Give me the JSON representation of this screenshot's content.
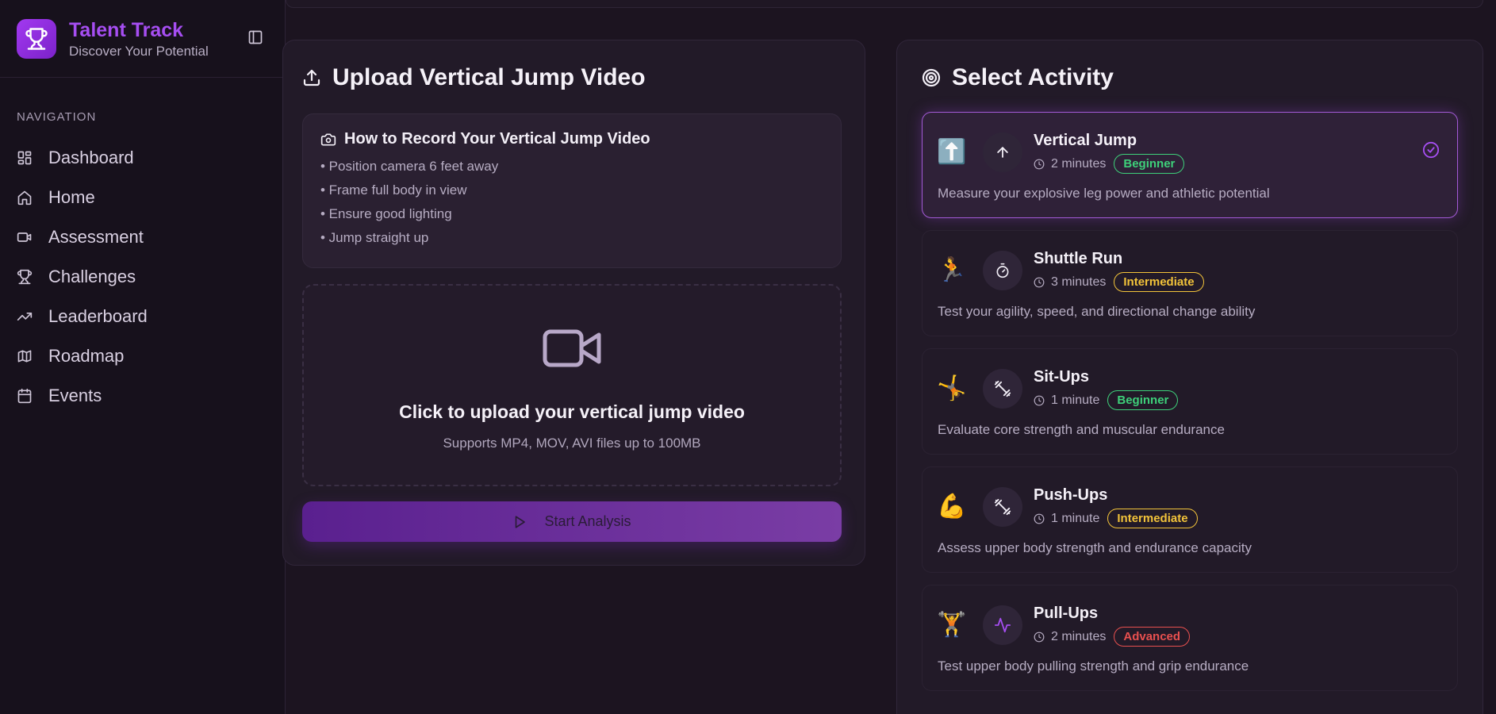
{
  "brand": {
    "title": "Talent Track",
    "subtitle": "Discover Your Potential"
  },
  "sidebar": {
    "section_label": "NAVIGATION",
    "items": [
      {
        "label": "Dashboard",
        "icon": "dashboard-icon"
      },
      {
        "label": "Home",
        "icon": "home-icon"
      },
      {
        "label": "Assessment",
        "icon": "video-icon"
      },
      {
        "label": "Challenges",
        "icon": "trophy-icon"
      },
      {
        "label": "Leaderboard",
        "icon": "trending-up-icon"
      },
      {
        "label": "Roadmap",
        "icon": "map-icon"
      },
      {
        "label": "Events",
        "icon": "calendar-icon"
      }
    ]
  },
  "upload": {
    "title": "Upload Vertical Jump Video",
    "howto_title": "How to Record Your Vertical Jump Video",
    "tips": [
      "• Position camera 6 feet away",
      "• Frame full body in view",
      "• Ensure good lighting",
      "• Jump straight up"
    ],
    "drop_title": "Click to upload your vertical jump video",
    "drop_sub": "Supports MP4, MOV, AVI files up to 100MB",
    "start_label": "Start Analysis"
  },
  "activities": {
    "title": "Select Activity",
    "items": [
      {
        "name": "Vertical Jump",
        "emoji": "⬆️",
        "icon": "arrow-up-icon",
        "duration": "2 minutes",
        "level": "Beginner",
        "level_color": "#3ed07a",
        "description": "Measure your explosive leg power and athletic potential",
        "selected": true
      },
      {
        "name": "Shuttle Run",
        "emoji": "🏃",
        "icon": "timer-icon",
        "duration": "3 minutes",
        "level": "Intermediate",
        "level_color": "#f2c33a",
        "description": "Test your agility, speed, and directional change ability",
        "selected": false
      },
      {
        "name": "Sit-Ups",
        "emoji": "🤸",
        "icon": "dumbbell-icon",
        "duration": "1 minute",
        "level": "Beginner",
        "level_color": "#3ed07a",
        "description": "Evaluate core strength and muscular endurance",
        "selected": false
      },
      {
        "name": "Push-Ups",
        "emoji": "💪",
        "icon": "dumbbell-icon",
        "duration": "1 minute",
        "level": "Intermediate",
        "level_color": "#f2c33a",
        "description": "Assess upper body strength and endurance capacity",
        "selected": false
      },
      {
        "name": "Pull-Ups",
        "emoji": "🏋️",
        "icon": "activity-icon",
        "duration": "2 minutes",
        "level": "Advanced",
        "level_color": "#e8504f",
        "description": "Test upper body pulling strength and grip endurance",
        "selected": false
      }
    ]
  },
  "colors": {
    "accent": "#a64ef2",
    "beginner": "#3ed07a",
    "intermediate": "#f2c33a",
    "advanced": "#e8504f"
  }
}
